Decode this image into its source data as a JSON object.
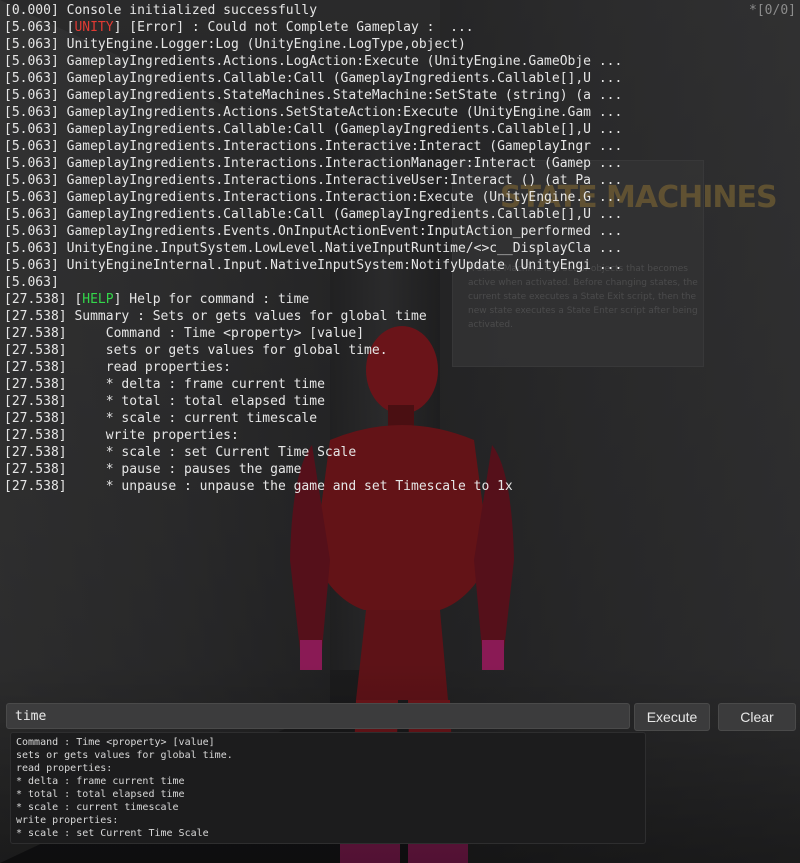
{
  "counter": "*[0/0]",
  "log": [
    {
      "ts": "[0.000]",
      "pre": " ",
      "tag": "",
      "tag_class": "",
      "text": "Console initialized successfully"
    },
    {
      "ts": "[5.063]",
      "pre": " [",
      "tag": "UNITY",
      "tag_class": "tag-unity",
      "text": "] [Error] : Could not Complete Gameplay :  ..."
    },
    {
      "ts": "[5.063]",
      "pre": " ",
      "tag": "",
      "tag_class": "",
      "text": "UnityEngine.Logger:Log (UnityEngine.LogType,object)"
    },
    {
      "ts": "[5.063]",
      "pre": " ",
      "tag": "",
      "tag_class": "",
      "text": "GameplayIngredients.Actions.LogAction:Execute (UnityEngine.GameObje ..."
    },
    {
      "ts": "[5.063]",
      "pre": " ",
      "tag": "",
      "tag_class": "",
      "text": "GameplayIngredients.Callable:Call (GameplayIngredients.Callable[],U ..."
    },
    {
      "ts": "[5.063]",
      "pre": " ",
      "tag": "",
      "tag_class": "",
      "text": "GameplayIngredients.StateMachines.StateMachine:SetState (string) (a ..."
    },
    {
      "ts": "[5.063]",
      "pre": " ",
      "tag": "",
      "tag_class": "",
      "text": "GameplayIngredients.Actions.SetStateAction:Execute (UnityEngine.Gam ..."
    },
    {
      "ts": "[5.063]",
      "pre": " ",
      "tag": "",
      "tag_class": "",
      "text": "GameplayIngredients.Callable:Call (GameplayIngredients.Callable[],U ..."
    },
    {
      "ts": "[5.063]",
      "pre": " ",
      "tag": "",
      "tag_class": "",
      "text": "GameplayIngredients.Interactions.Interactive:Interact (GameplayIngr ..."
    },
    {
      "ts": "[5.063]",
      "pre": " ",
      "tag": "",
      "tag_class": "",
      "text": "GameplayIngredients.Interactions.InteractionManager:Interact (Gamep ..."
    },
    {
      "ts": "[5.063]",
      "pre": " ",
      "tag": "",
      "tag_class": "",
      "text": "GameplayIngredients.Interactions.InteractiveUser:Interact () (at Pa ..."
    },
    {
      "ts": "[5.063]",
      "pre": " ",
      "tag": "",
      "tag_class": "",
      "text": "GameplayIngredients.Interactions.Interaction:Execute (UnityEngine.G ..."
    },
    {
      "ts": "[5.063]",
      "pre": " ",
      "tag": "",
      "tag_class": "",
      "text": "GameplayIngredients.Callable:Call (GameplayIngredients.Callable[],U ..."
    },
    {
      "ts": "[5.063]",
      "pre": " ",
      "tag": "",
      "tag_class": "",
      "text": "GameplayIngredients.Events.OnInputActionEvent:InputAction_performed ..."
    },
    {
      "ts": "[5.063]",
      "pre": " ",
      "tag": "",
      "tag_class": "",
      "text": "UnityEngine.InputSystem.LowLevel.NativeInputRuntime/<>c__DisplayCla ..."
    },
    {
      "ts": "[5.063]",
      "pre": " ",
      "tag": "",
      "tag_class": "",
      "text": "UnityEngineInternal.Input.NativeInputSystem:NotifyUpdate (UnityEngi ..."
    },
    {
      "ts": "[5.063]",
      "pre": "",
      "tag": "",
      "tag_class": "",
      "text": ""
    },
    {
      "ts": "[27.538]",
      "pre": " [",
      "tag": "HELP",
      "tag_class": "tag-help",
      "text": "] Help for command : time"
    },
    {
      "ts": "[27.538]",
      "pre": " ",
      "tag": "",
      "tag_class": "",
      "text": "Summary : Sets or gets values for global time"
    },
    {
      "ts": "[27.538]",
      "pre": " ",
      "tag": "",
      "tag_class": "",
      "text": "    Command : Time <property> [value]"
    },
    {
      "ts": "[27.538]",
      "pre": " ",
      "tag": "",
      "tag_class": "",
      "text": "    sets or gets values for global time."
    },
    {
      "ts": "[27.538]",
      "pre": " ",
      "tag": "",
      "tag_class": "",
      "text": "    read properties:"
    },
    {
      "ts": "[27.538]",
      "pre": " ",
      "tag": "",
      "tag_class": "",
      "text": "    * delta : frame current time"
    },
    {
      "ts": "[27.538]",
      "pre": " ",
      "tag": "",
      "tag_class": "",
      "text": "    * total : total elapsed time"
    },
    {
      "ts": "[27.538]",
      "pre": " ",
      "tag": "",
      "tag_class": "",
      "text": "    * scale : current timescale"
    },
    {
      "ts": "[27.538]",
      "pre": " ",
      "tag": "",
      "tag_class": "",
      "text": "    write properties:"
    },
    {
      "ts": "[27.538]",
      "pre": " ",
      "tag": "",
      "tag_class": "",
      "text": "    * scale : set Current Time Scale"
    },
    {
      "ts": "[27.538]",
      "pre": " ",
      "tag": "",
      "tag_class": "",
      "text": "    * pause : pauses the game"
    },
    {
      "ts": "[27.538]",
      "pre": " ",
      "tag": "",
      "tag_class": "",
      "text": "    * unpause : unpause the game and set Timescale to 1x"
    }
  ],
  "input": {
    "value": "time"
  },
  "buttons": {
    "execute": "Execute",
    "clear": "Clear"
  },
  "hint_lines": [
    "Command : Time <property> [value]",
    "sets or gets values for global time.",
    "read properties:",
    "* delta : frame current time",
    "* total : total elapsed time",
    "* scale : current timescale",
    "write properties:",
    "* scale : set Current Time Scale"
  ],
  "scene": {
    "sign_title": "STATE MACHINES",
    "sign_text": "A State Machine is a set of objects that becomes active when activated. Before changing states, the current state executes a State Exit script, then the new state executes a State Enter script after being activated."
  }
}
